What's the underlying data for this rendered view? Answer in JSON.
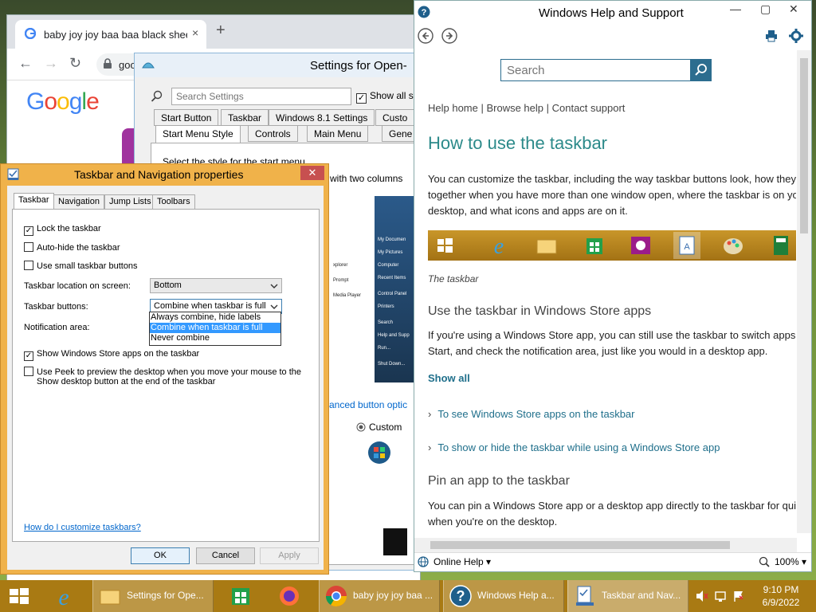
{
  "chrome": {
    "tab_title": "baby joy joy baa baa black sheep",
    "tab_close": "×",
    "new_tab": "+",
    "back": "←",
    "forward": "→",
    "reload": "↻",
    "url": "goo",
    "logo": "Google"
  },
  "open_shell": {
    "title": "Settings for Open-",
    "search_placeholder": "Search Settings",
    "show_all": "Show all s",
    "tabs_row1": [
      "Start Button",
      "Taskbar",
      "Windows 8.1 Settings",
      "Custo"
    ],
    "tabs_row2": [
      "Start Menu Style",
      "Controls",
      "Main Menu",
      "Gene"
    ],
    "style_label": "Select the style for the start menu.",
    "two_columns": "with two columns",
    "preview_left": [
      "xplorer",
      "Prompt",
      "Media Player"
    ],
    "preview_right": [
      "My Documen",
      "My Pictures",
      "Computer",
      "Recent Items",
      "Control Panel",
      "Printers",
      "Search",
      "Help and Supp",
      "Run...",
      "Shut Down..."
    ],
    "advanced_link": "anced button optic",
    "custom_label": "Custom"
  },
  "help": {
    "title": "Windows Help and Support",
    "search_placeholder": "Search",
    "nav_links": "Help home | Browse help | Contact support",
    "heading": "How to use the taskbar",
    "intro": [
      "You can customize the taskbar, including the way taskbar buttons look, how they",
      "together when you have more than one window open, where the taskbar is on yo",
      "desktop, and what icons and apps are on it."
    ],
    "caption": "The taskbar",
    "section1": "Use the taskbar in Windows Store apps",
    "section1_text": [
      "If you're using a Windows Store app, you can still use the taskbar to switch apps,",
      "Start, and check the notification area, just like you would in a desktop app."
    ],
    "show_all": "Show all",
    "expand1": "To see Windows Store apps on the taskbar",
    "expand2": "To show or hide the taskbar while using a Windows Store app",
    "section2": "Pin an app to the taskbar",
    "section2_text": [
      "You can pin a Windows Store app or a desktop app directly to the taskbar for qui",
      "when you're on the desktop."
    ],
    "online_help": "Online Help",
    "zoom": "100%"
  },
  "props": {
    "title": "Taskbar and Navigation properties",
    "tabs": [
      "Taskbar",
      "Navigation",
      "Jump Lists",
      "Toolbars"
    ],
    "lock": "Lock the taskbar",
    "autohide": "Auto-hide the taskbar",
    "small_buttons": "Use small taskbar buttons",
    "location_label": "Taskbar location on screen:",
    "location_value": "Bottom",
    "buttons_label": "Taskbar buttons:",
    "buttons_value": "Combine when taskbar is full",
    "buttons_options": [
      "Always combine, hide labels",
      "Combine when taskbar is full",
      "Never combine"
    ],
    "notification_label": "Notification area:",
    "store_apps": "Show Windows Store apps on the taskbar",
    "peek_line1": "Use Peek to preview the desktop when you move your mouse to the",
    "peek_line2": "Show desktop button at the end of the taskbar",
    "help_link": "How do I customize taskbars?",
    "ok": "OK",
    "cancel": "Cancel",
    "apply": "Apply"
  },
  "taskbar": {
    "items": [
      {
        "label": "Settings for Ope..."
      },
      {
        "label": "baby joy joy baa ..."
      },
      {
        "label": "Windows Help a..."
      },
      {
        "label": "Taskbar and Nav..."
      }
    ],
    "time": "9:10 PM",
    "date": "6/9/2022"
  },
  "colors": {
    "help_accent": "#2c8a8a",
    "dialog_frame": "#f0b24a",
    "taskbar": "#a97a13"
  }
}
